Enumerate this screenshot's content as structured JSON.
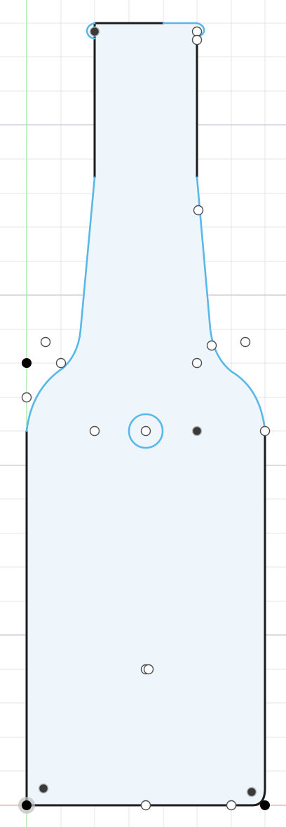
{
  "app": {
    "view": "sketch-canvas"
  },
  "colors": {
    "background": "#ffffff",
    "grid_minor": "#e4e6ea",
    "grid_major": "#c4c7cc",
    "axis_vertical": "#9fe59b",
    "axis_horizontal": "#f3a3a3",
    "profile_fill": "#eef6fc",
    "line_constrained": "#1b1b1b",
    "line_unconstrained": "#5ab8e8",
    "point_outline": "#4d4d4d",
    "point_fill_open": "#ffffff",
    "point_fill_solid": "#000000"
  },
  "sketch": {
    "profile": "bottle",
    "points_open": 14,
    "points_solid": 6,
    "center_marker": "circle-center-icon"
  }
}
